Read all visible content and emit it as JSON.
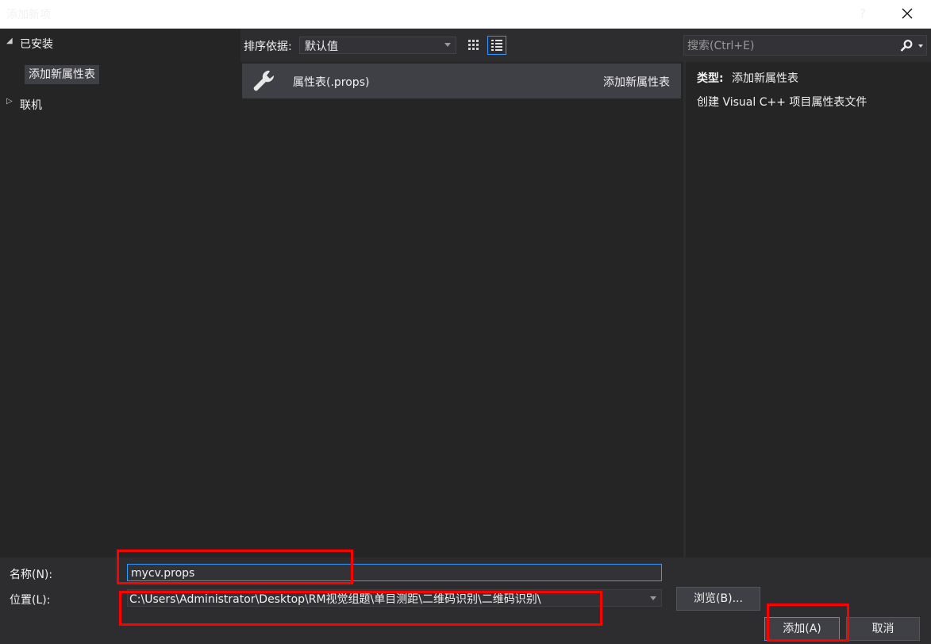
{
  "window": {
    "title": "添加新项",
    "help_label": "?"
  },
  "tree": {
    "installed_label": "已安装",
    "installed_children": [
      "添加新属性表"
    ],
    "online_label": "联机"
  },
  "toolbar": {
    "sort_label": "排序依据:",
    "sort_value": "默认值"
  },
  "search": {
    "placeholder": "搜索(Ctrl+E)"
  },
  "templates": [
    {
      "name": "属性表(.props)",
      "category": "添加新属性表",
      "icon": "wrench-icon"
    }
  ],
  "details": {
    "type_label": "类型:",
    "type_value": "添加新属性表",
    "description": "创建 Visual C++ 项目属性表文件"
  },
  "form": {
    "name_label": "名称(N):",
    "name_value": "mycv.props",
    "location_label": "位置(L):",
    "location_value": "C:\\Users\\Administrator\\Desktop\\RM视觉组题\\单目测距\\二维码识别\\二维码识别\\",
    "browse_label": "浏览(B)..."
  },
  "buttons": {
    "add_label": "添加(A)",
    "cancel_label": "取消"
  },
  "colors": {
    "background": "#2d2d30",
    "pane": "#252526",
    "selected": "#3f3f46",
    "accent": "#3399ff",
    "annotation": "#ff0000"
  }
}
